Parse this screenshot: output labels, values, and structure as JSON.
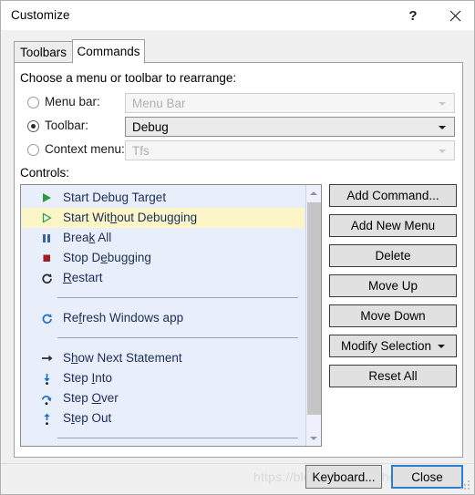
{
  "window": {
    "title": "Customize",
    "help_icon": "question-mark-icon",
    "close_icon": "close-icon"
  },
  "tabs": [
    {
      "id": "toolbars",
      "label": "Toolbars",
      "active": false
    },
    {
      "id": "commands",
      "label": "Commands",
      "active": true
    }
  ],
  "panel": {
    "choose_label": "Choose a menu or toolbar to rearrange:",
    "controls_label": "Controls:",
    "radio_rows": [
      {
        "id": "menu-bar",
        "label": "Menu bar:",
        "selected": false,
        "value": "Menu Bar",
        "enabled": false
      },
      {
        "id": "toolbar",
        "label": "Toolbar:",
        "selected": true,
        "value": "Debug",
        "enabled": true
      },
      {
        "id": "context-menu",
        "label": "Context menu:",
        "selected": false,
        "value": "Tfs",
        "enabled": false
      }
    ]
  },
  "commands_list": {
    "items": [
      {
        "label": "Start Debug Target",
        "mnemonic": "",
        "icon": "play-filled-icon",
        "selected": false
      },
      {
        "label": "Start Without Debugging",
        "mnemonic": "h",
        "icon": "play-outline-icon",
        "selected": true
      },
      {
        "label": "Break All",
        "mnemonic": "k",
        "icon": "pause-icon",
        "selected": false
      },
      {
        "label": "Stop Debugging",
        "mnemonic": "e",
        "icon": "stop-square-icon",
        "selected": false
      },
      {
        "label": "Restart",
        "mnemonic": "R",
        "icon": "restart-icon",
        "selected": false
      },
      {
        "separator": true
      },
      {
        "label": "Refresh Windows app",
        "mnemonic": "f",
        "icon": "refresh-icon",
        "selected": false
      },
      {
        "separator": true
      },
      {
        "label": "Show Next Statement",
        "mnemonic": "h",
        "icon": "arrow-right-icon",
        "selected": false
      },
      {
        "label": "Step Into",
        "mnemonic": "I",
        "icon": "step-into-icon",
        "selected": false
      },
      {
        "label": "Step Over",
        "mnemonic": "O",
        "icon": "step-over-icon",
        "selected": false
      },
      {
        "label": "Step Out",
        "mnemonic": "t",
        "icon": "step-out-icon",
        "selected": false
      },
      {
        "separator": true
      }
    ],
    "scrollbar": {
      "up_icon": "chevron-up-icon",
      "down_icon": "chevron-down-icon"
    }
  },
  "side_buttons": [
    {
      "id": "add-command",
      "label": "Add Command...",
      "dropdown": false
    },
    {
      "id": "add-new-menu",
      "label": "Add New Menu",
      "dropdown": false
    },
    {
      "id": "delete",
      "label": "Delete",
      "dropdown": false
    },
    {
      "id": "move-up",
      "label": "Move Up",
      "dropdown": false
    },
    {
      "id": "move-down",
      "label": "Move Down",
      "dropdown": false
    },
    {
      "id": "modify-selection",
      "label": "Modify Selection",
      "dropdown": true
    },
    {
      "id": "reset-all",
      "label": "Reset All",
      "dropdown": false
    }
  ],
  "footer": {
    "keyboard_label": "Keyboard...",
    "close_label": "Close"
  },
  "watermark": "https://blog.csdn.net/chengyzj116",
  "colors": {
    "accent": "#2a7fd4",
    "selection": "#fcf5c8",
    "list_background": "#e9eefb",
    "list_text": "#1c2d56",
    "play_green": "#2e9b3a",
    "pause_blue": "#3c5fa0",
    "stop_red": "#a02020",
    "step_blue": "#1f6fc4"
  }
}
